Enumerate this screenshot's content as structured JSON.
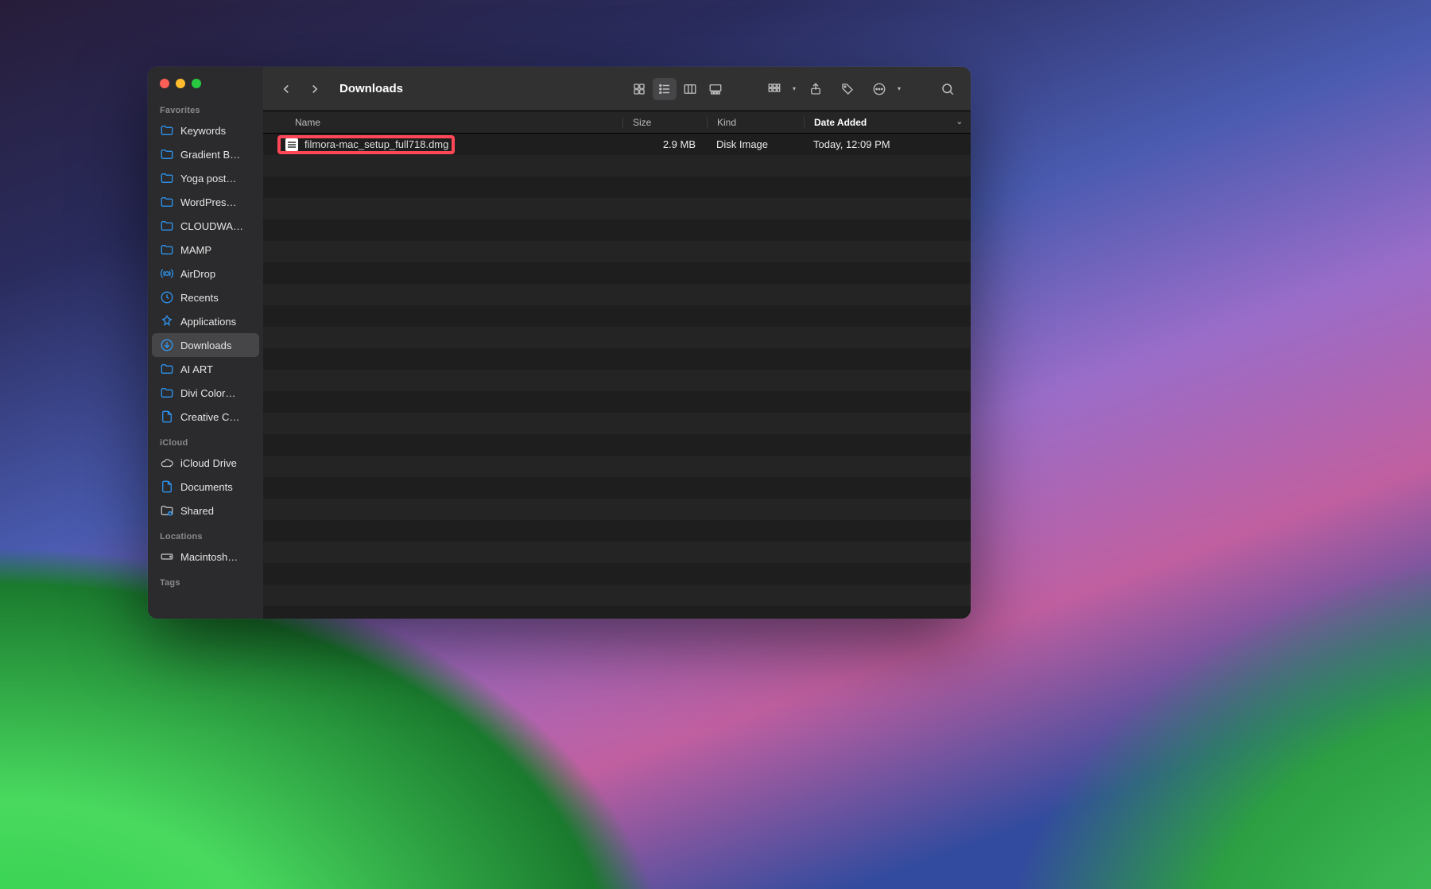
{
  "window": {
    "title": "Downloads"
  },
  "sidebar": {
    "sections": [
      {
        "label": "Favorites",
        "items": [
          {
            "icon": "folder",
            "name": "Keywords"
          },
          {
            "icon": "folder",
            "name": "Gradient B…"
          },
          {
            "icon": "folder",
            "name": "Yoga post…"
          },
          {
            "icon": "folder",
            "name": "WordPres…"
          },
          {
            "icon": "folder",
            "name": "CLOUDWA…"
          },
          {
            "icon": "folder",
            "name": "MAMP"
          },
          {
            "icon": "airdrop",
            "name": "AirDrop"
          },
          {
            "icon": "clock",
            "name": "Recents"
          },
          {
            "icon": "apps",
            "name": "Applications"
          },
          {
            "icon": "download",
            "name": "Downloads",
            "active": true
          },
          {
            "icon": "folder",
            "name": "AI ART"
          },
          {
            "icon": "folder",
            "name": "Divi Color…"
          },
          {
            "icon": "doc",
            "name": "Creative C…"
          }
        ]
      },
      {
        "label": "iCloud",
        "items": [
          {
            "icon": "cloud",
            "name": "iCloud Drive"
          },
          {
            "icon": "doc",
            "name": "Documents"
          },
          {
            "icon": "shared",
            "name": "Shared"
          }
        ]
      },
      {
        "label": "Locations",
        "items": [
          {
            "icon": "disk",
            "name": "Macintosh…"
          }
        ]
      },
      {
        "label": "Tags",
        "items": []
      }
    ]
  },
  "columns": {
    "name": "Name",
    "size": "Size",
    "kind": "Kind",
    "date": "Date Added"
  },
  "files": [
    {
      "name": "filmora-mac_setup_full718.dmg",
      "size": "2.9 MB",
      "kind": "Disk Image",
      "date": "Today, 12:09 PM",
      "highlighted": true
    }
  ],
  "toolbar": {
    "back": "Back",
    "forward": "Forward",
    "view_icons": "Icon view",
    "view_list": "List view",
    "view_columns": "Column view",
    "view_gallery": "Gallery view",
    "group": "Group",
    "share": "Share",
    "tags": "Tags",
    "actions": "Actions",
    "search": "Search"
  }
}
